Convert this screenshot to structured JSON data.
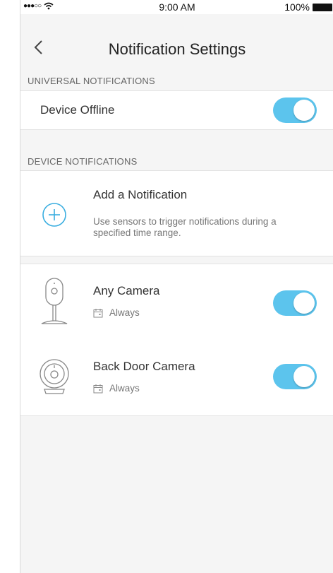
{
  "status_bar": {
    "signal": "●●●○○",
    "time": "9:00 AM",
    "battery": "100%"
  },
  "header": {
    "title": "Notification Settings"
  },
  "universal": {
    "section_title": "UNIVERSAL NOTIFICATIONS",
    "items": [
      {
        "label": "Device Offline",
        "enabled": true
      }
    ]
  },
  "device": {
    "section_title": "DEVICE NOTIFICATIONS",
    "add": {
      "title": "Add a Notification",
      "description_line1": "Use sensors to trigger notifications during a",
      "description_line2": "specified time range."
    },
    "cameras": [
      {
        "name": "Any Camera",
        "schedule": "Always",
        "enabled": true,
        "icon": "camera-icon"
      },
      {
        "name": "Back Door Camera",
        "schedule": "Always",
        "enabled": true,
        "icon": "round-camera-icon"
      }
    ]
  },
  "colors": {
    "toggle_on": "#5cc4ed",
    "accent": "#3aaee0"
  }
}
